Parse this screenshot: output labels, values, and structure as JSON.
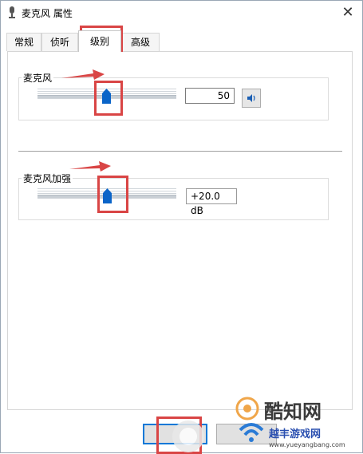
{
  "window": {
    "title": "麦克风 属性",
    "close_glyph": "✕"
  },
  "tabs": [
    {
      "label": "常规",
      "active": false
    },
    {
      "label": "侦听",
      "active": false
    },
    {
      "label": "级别",
      "active": true
    },
    {
      "label": "高级",
      "active": false
    }
  ],
  "microphone": {
    "label": "麦克风",
    "value": "50",
    "level": 0.5
  },
  "boost": {
    "label": "麦克风加强",
    "value": "+20.0 dB",
    "level": 0.5
  },
  "watermark": {
    "brand": "酷知网",
    "site_cn": "越丰游戏网",
    "site_url": "www.yueyangbang.com"
  },
  "colors": {
    "accent": "#0078d7",
    "callout": "#d94545",
    "thumb": "#0a64c8"
  }
}
